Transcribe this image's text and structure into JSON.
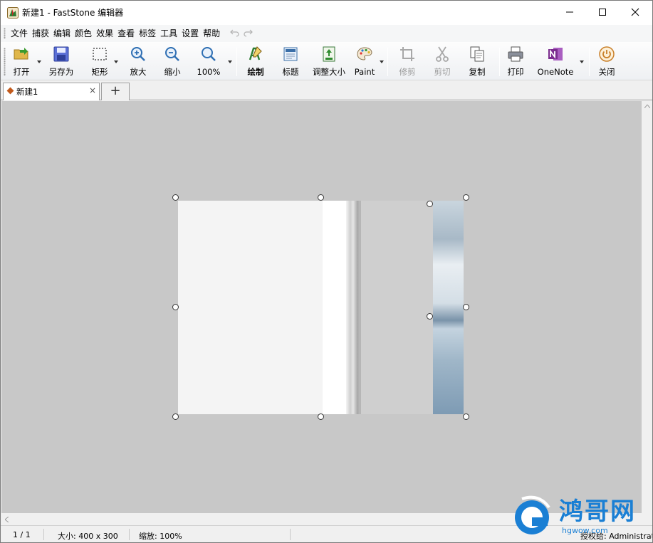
{
  "window": {
    "title": "新建1 - FastStone 编辑器",
    "controls": {
      "minimize": "minimize-icon",
      "maximize": "maximize-icon",
      "close": "close-icon"
    }
  },
  "menu": {
    "items": [
      "文件",
      "捕获",
      "编辑",
      "颜色",
      "效果",
      "查看",
      "标签",
      "工具",
      "设置",
      "帮助"
    ]
  },
  "toolbar": {
    "open": "打开",
    "save_as": "另存为",
    "rectangle": "矩形",
    "zoom_in": "放大",
    "zoom_out": "缩小",
    "zoom_level": "100%",
    "draw": "绘制",
    "caption": "标题",
    "resize": "调整大小",
    "paint": "Paint",
    "crop": "修剪",
    "cut": "剪切",
    "copy": "复制",
    "print": "打印",
    "onenote": "OneNote",
    "close": "关闭"
  },
  "tabs": {
    "active": "新建1",
    "close_glyph": "×",
    "new_glyph": "+"
  },
  "status": {
    "page": "1 / 1",
    "size": "大小: 400 x 300",
    "zoom": "缩放: 100%",
    "license": "授权给: Administrator"
  },
  "watermark": {
    "text": "鸿哥网",
    "url": "hgwow.com"
  },
  "colors": {
    "canvas_bg": "#c8c8c8",
    "tab_marker": "#c25a1c",
    "onenote_purple": "#7b2d8e",
    "watermark_blue": "#1a7fd4"
  }
}
